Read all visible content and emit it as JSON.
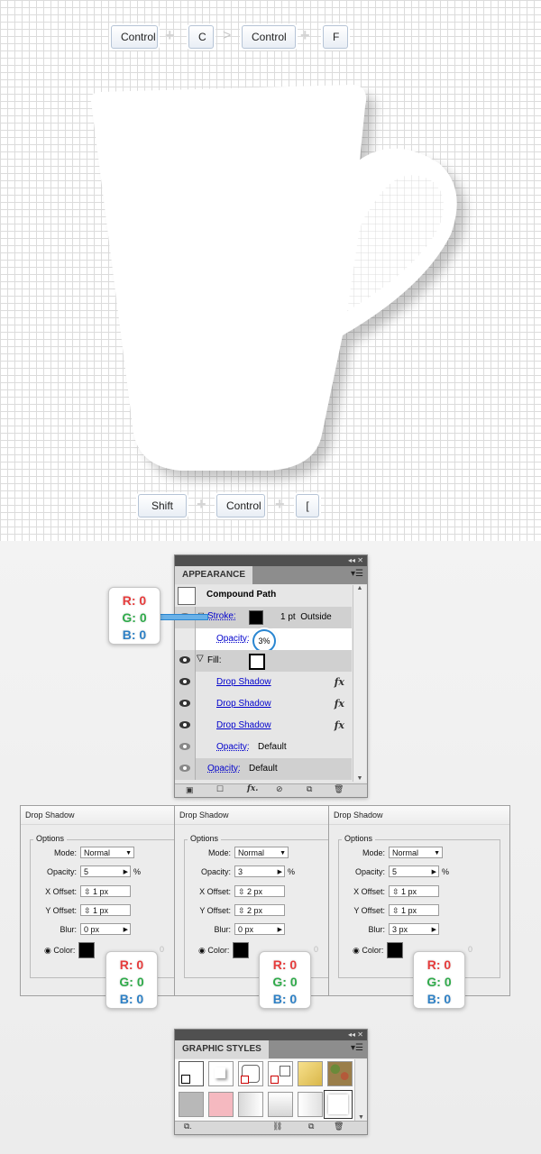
{
  "shortcut_copy": {
    "key1": "Control",
    "key2": "C",
    "key3": "Control",
    "key4": "F"
  },
  "shortcut_back": {
    "key1": "Shift",
    "key2": "Control",
    "key3": "["
  },
  "appearance": {
    "tab": "APPEARANCE",
    "object": "Compound Path",
    "stroke_label": "Stroke:",
    "stroke_value": "1 pt  Outside",
    "stroke_opacity_label": "Opacity:",
    "stroke_opacity_value": "3%",
    "fill_label": "Fill:",
    "effects": [
      "Drop Shadow",
      "Drop Shadow",
      "Drop Shadow"
    ],
    "fill_opacity_label": "Opacity:",
    "fill_opacity_value": "Default",
    "object_opacity_label": "Opacity:",
    "object_opacity_value": "Default",
    "fx_glyph": "fx"
  },
  "rgb_labels": {
    "r": "R: 0",
    "g": "G: 0",
    "b": "B: 0"
  },
  "drop_shadow_dialogs": [
    {
      "title": "Drop Shadow",
      "group": "Options",
      "mode_label": "Mode:",
      "mode": "Normal",
      "opacity_label": "Opacity:",
      "opacity": "5",
      "percent": "%",
      "x_label": "X Offset:",
      "x_offset": "1 px",
      "y_label": "Y Offset:",
      "y_offset": "1 px",
      "blur_label": "Blur:",
      "blur": "0 px",
      "color_label": "Color:",
      "hidden_field": "0"
    },
    {
      "title": "Drop Shadow",
      "group": "Options",
      "mode_label": "Mode:",
      "mode": "Normal",
      "opacity_label": "Opacity:",
      "opacity": "3",
      "percent": "%",
      "x_label": "X Offset:",
      "x_offset": "2 px",
      "y_label": "Y Offset:",
      "y_offset": "2 px",
      "blur_label": "Blur:",
      "blur": "0 px",
      "color_label": "Color:",
      "hidden_field": "0"
    },
    {
      "title": "Drop Shadow",
      "group": "Options",
      "mode_label": "Mode:",
      "mode": "Normal",
      "opacity_label": "Opacity:",
      "opacity": "5",
      "percent": "%",
      "x_label": "X Offset:",
      "x_offset": "1 px",
      "y_label": "Y Offset:",
      "y_offset": "1 px",
      "blur_label": "Blur:",
      "blur": "3 px",
      "color_label": "Color:",
      "hidden_field": "0"
    }
  ],
  "graphic_styles": {
    "tab": "GRAPHIC STYLES"
  },
  "colors": {
    "panel_dark": "#505050",
    "link_blue": "#0000cc",
    "highlight_blue": "#2a86d1",
    "r_red": "#e53b3b",
    "g_green": "#2faa4a",
    "b_blue": "#2c7fc4"
  }
}
